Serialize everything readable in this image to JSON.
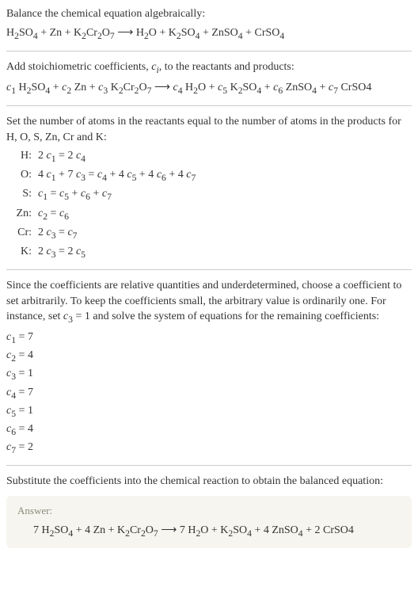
{
  "intro1": "Balance the chemical equation algebraically:",
  "eq1_html": "H<sub>2</sub>SO<sub>4</sub> + Zn + K<sub>2</sub>Cr<sub>2</sub>O<sub>7</sub> ⟶ H<sub>2</sub>O + K<sub>2</sub>SO<sub>4</sub> + ZnSO<sub>4</sub> + CrSO<sub>4</sub>",
  "intro2_html": "Add stoichiometric coefficients, <i>c<sub>i</sub></i>, to the reactants and products:",
  "eq2_html": "<i>c</i><sub>1</sub> H<sub>2</sub>SO<sub>4</sub> + <i>c</i><sub>2</sub> Zn + <i>c</i><sub>3</sub> K<sub>2</sub>Cr<sub>2</sub>O<sub>7</sub> ⟶ <i>c</i><sub>4</sub> H<sub>2</sub>O + <i>c</i><sub>5</sub> K<sub>2</sub>SO<sub>4</sub> + <i>c</i><sub>6</sub> ZnSO<sub>4</sub> + <i>c</i><sub>7</sub> CrSO4",
  "intro3": "Set the number of atoms in the reactants equal to the number of atoms in the products for H, O, S, Zn, Cr and K:",
  "atoms": [
    {
      "el": "H:",
      "eq": "2 <i>c</i><sub>1</sub> = 2 <i>c</i><sub>4</sub>"
    },
    {
      "el": "O:",
      "eq": "4 <i>c</i><sub>1</sub> + 7 <i>c</i><sub>3</sub> = <i>c</i><sub>4</sub> + 4 <i>c</i><sub>5</sub> + 4 <i>c</i><sub>6</sub> + 4 <i>c</i><sub>7</sub>"
    },
    {
      "el": "S:",
      "eq": "<i>c</i><sub>1</sub> = <i>c</i><sub>5</sub> + <i>c</i><sub>6</sub> + <i>c</i><sub>7</sub>"
    },
    {
      "el": "Zn:",
      "eq": "<i>c</i><sub>2</sub> = <i>c</i><sub>6</sub>"
    },
    {
      "el": "Cr:",
      "eq": "2 <i>c</i><sub>3</sub> = <i>c</i><sub>7</sub>"
    },
    {
      "el": "K:",
      "eq": "2 <i>c</i><sub>3</sub> = 2 <i>c</i><sub>5</sub>"
    }
  ],
  "intro4_html": "Since the coefficients are relative quantities and underdetermined, choose a coefficient to set arbitrarily. To keep the coefficients small, the arbitrary value is ordinarily one. For instance, set <i>c</i><sub>3</sub> = 1 and solve the system of equations for the remaining coefficients:",
  "coeffs": [
    "<i>c</i><sub>1</sub> = 7",
    "<i>c</i><sub>2</sub> = 4",
    "<i>c</i><sub>3</sub> = 1",
    "<i>c</i><sub>4</sub> = 7",
    "<i>c</i><sub>5</sub> = 1",
    "<i>c</i><sub>6</sub> = 4",
    "<i>c</i><sub>7</sub> = 2"
  ],
  "intro5": "Substitute the coefficients into the chemical reaction to obtain the balanced equation:",
  "answer_label": "Answer:",
  "answer_html": "7 H<sub>2</sub>SO<sub>4</sub> + 4 Zn + K<sub>2</sub>Cr<sub>2</sub>O<sub>7</sub> ⟶ 7 H<sub>2</sub>O + K<sub>2</sub>SO<sub>4</sub> + 4 ZnSO<sub>4</sub> + 2 CrSO4"
}
